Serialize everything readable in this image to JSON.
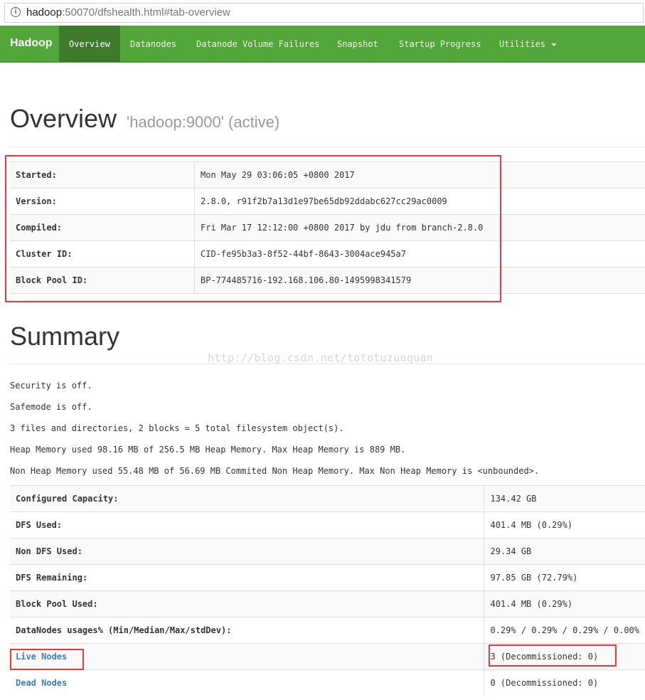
{
  "browser": {
    "url_host": "hadoop",
    "url_rest": ":50070/dfshealth.html#tab-overview"
  },
  "navbar": {
    "brand": "Hadoop",
    "items": [
      {
        "label": "Overview"
      },
      {
        "label": "Datanodes"
      },
      {
        "label": "Datanode Volume Failures"
      },
      {
        "label": "Snapshot"
      },
      {
        "label": "Startup Progress"
      },
      {
        "label": "Utilities"
      }
    ]
  },
  "overview": {
    "title": "Overview",
    "subtitle": "'hadoop:9000' (active)",
    "rows": [
      {
        "key": "Started:",
        "value": "Mon May 29 03:06:05 +0800 2017"
      },
      {
        "key": "Version:",
        "value": "2.8.0, r91f2b7a13d1e97be65db92ddabc627cc29ac0009"
      },
      {
        "key": "Compiled:",
        "value": "Fri Mar 17 12:12:00 +0800 2017 by jdu from branch-2.8.0"
      },
      {
        "key": "Cluster ID:",
        "value": "CID-fe95b3a3-8f52-44bf-8643-3004ace945a7"
      },
      {
        "key": "Block Pool ID:",
        "value": "BP-774485716-192.168.106.80-1495998341579"
      }
    ]
  },
  "summary": {
    "title": "Summary",
    "watermark": "http://blog.csdn.net/tototuzuoquan",
    "status_lines": [
      "Security is off.",
      "Safemode is off.",
      "3 files and directories, 2 blocks = 5 total filesystem object(s).",
      "Heap Memory used 98.16 MB of 256.5 MB Heap Memory. Max Heap Memory is 889 MB.",
      "Non Heap Memory used 55.48 MB of 56.69 MB Commited Non Heap Memory. Max Non Heap Memory is <unbounded>."
    ],
    "rows": [
      {
        "key": "Configured Capacity:",
        "value": "134.42 GB"
      },
      {
        "key": "DFS Used:",
        "value": "401.4 MB (0.29%)"
      },
      {
        "key": "Non DFS Used:",
        "value": "29.34 GB"
      },
      {
        "key": "DFS Remaining:",
        "value": "97.85 GB (72.79%)"
      },
      {
        "key": "Block Pool Used:",
        "value": "401.4 MB (0.29%)"
      },
      {
        "key": "DataNodes usages% (Min/Median/Max/stdDev):",
        "value": "0.29% / 0.29% / 0.29% / 0.00%"
      },
      {
        "key": "Live Nodes",
        "value": "3 (Decommissioned: 0)"
      },
      {
        "key": "Dead Nodes",
        "value": "0 (Decommissioned: 0)"
      }
    ]
  },
  "colors": {
    "navbar": "#52a63a",
    "navbar_active": "#3d7a2c",
    "link": "#3c7fb9",
    "highlight": "#e03c3c"
  }
}
